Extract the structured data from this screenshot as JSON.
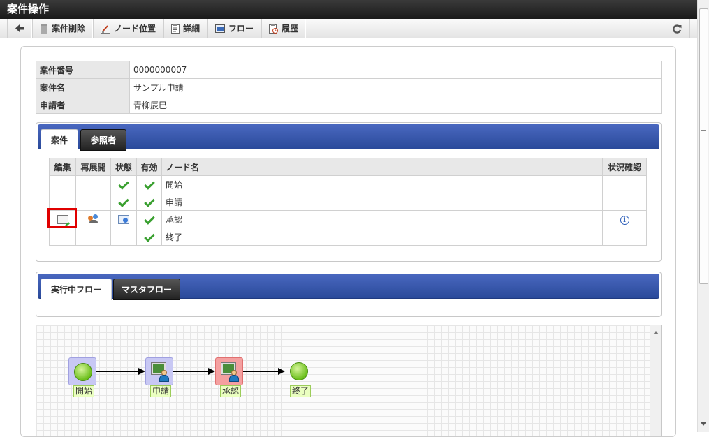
{
  "window": {
    "title": "案件操作"
  },
  "toolbar": {
    "back_icon": "arrow-left-icon",
    "delete_label": "案件削除",
    "node_position_label": "ノード位置",
    "detail_label": "詳細",
    "flow_label": "フロー",
    "history_label": "履歴",
    "refresh_icon": "refresh-icon"
  },
  "info": {
    "rows": [
      {
        "label": "案件番号",
        "value": "0000000007"
      },
      {
        "label": "案件名",
        "value": "サンプル申請"
      },
      {
        "label": "申請者",
        "value": "青柳辰巳"
      }
    ]
  },
  "case_tabs": {
    "active": "案件",
    "other": "参照者"
  },
  "node_table": {
    "headers": {
      "edit": "編集",
      "reopen": "再展開",
      "state": "状態",
      "valid": "有効",
      "name": "ノード名",
      "status_check": "状況確認"
    },
    "rows": [
      {
        "name": "開始",
        "state": "check",
        "valid": "check"
      },
      {
        "name": "申請",
        "state": "check",
        "valid": "check"
      },
      {
        "name": "承認",
        "state": "in-progress",
        "valid": "check",
        "edit": "edit-icon",
        "reopen": "users-icon",
        "status_check": "info-icon"
      },
      {
        "name": "終了",
        "state": "",
        "valid": "check"
      }
    ],
    "info_glyph": "i"
  },
  "flow_tabs": {
    "active": "実行中フロー",
    "other": "マスタフロー"
  },
  "flow": {
    "nodes": [
      {
        "label": "開始",
        "type": "start"
      },
      {
        "label": "申請",
        "type": "task"
      },
      {
        "label": "承認",
        "type": "task-current"
      },
      {
        "label": "終了",
        "type": "end"
      }
    ],
    "colors": {
      "done": "#c8c8f4",
      "current": "#f4a0a0",
      "line": "#000000"
    }
  }
}
